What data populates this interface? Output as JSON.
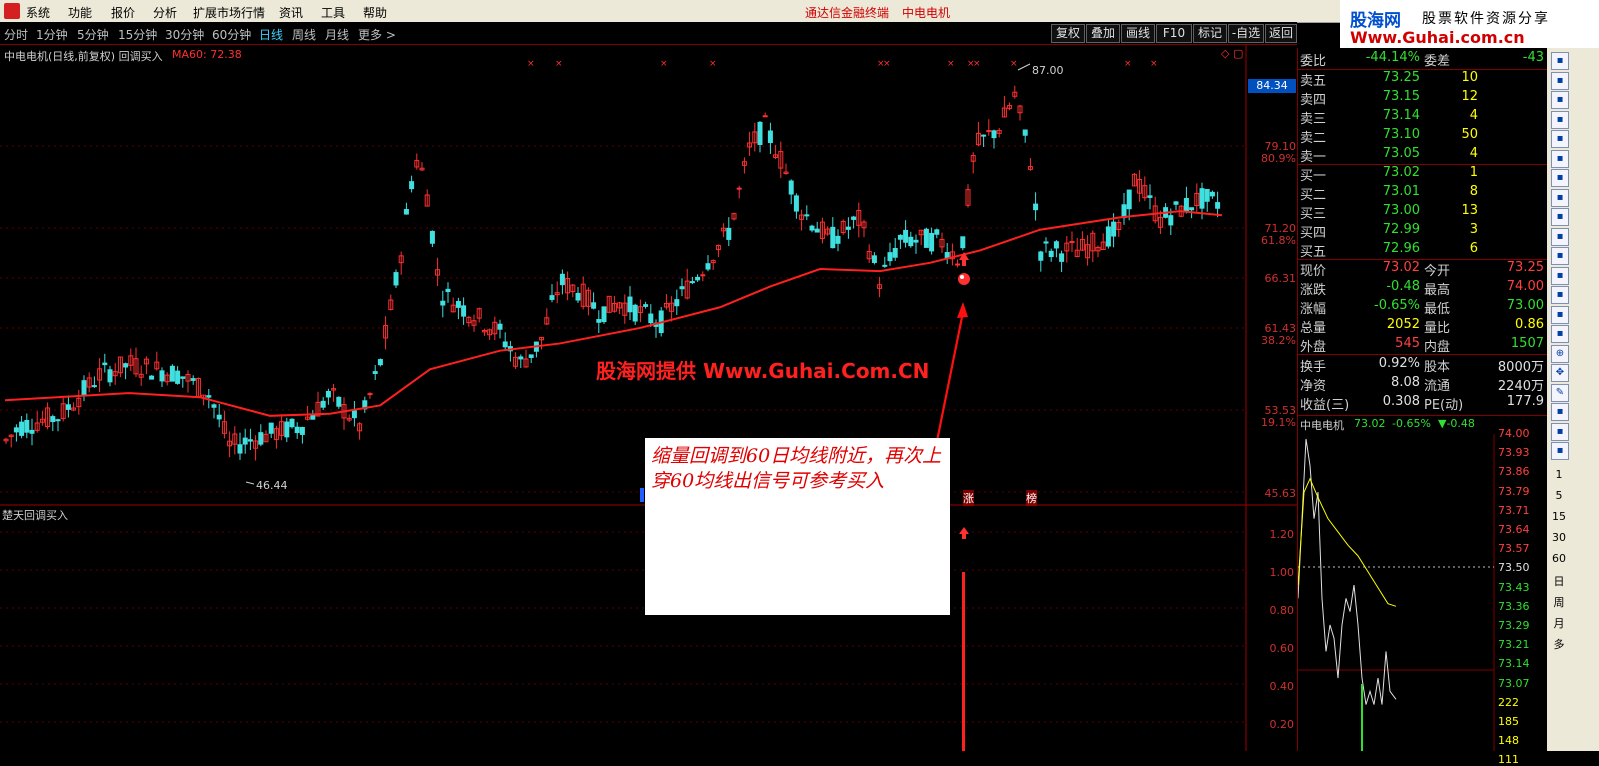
{
  "menubar": {
    "items": [
      "系统",
      "功能",
      "报价",
      "分析",
      "扩展市场行情",
      "资讯",
      "工具",
      "帮助"
    ],
    "app_title": "通达信金融终端",
    "stock_title": "中电电机"
  },
  "brand": {
    "name": "股海网",
    "slogan": "股票软件资源分享",
    "url": "Www.Guhai.com.cn"
  },
  "toolbar": {
    "periods": [
      "分时",
      "1分钟",
      "5分钟",
      "15分钟",
      "30分钟",
      "60分钟",
      "日线",
      "周线",
      "月线",
      "更多 >"
    ],
    "active_period": "日线",
    "buttons": [
      "复权",
      "叠加",
      "画线",
      "F10",
      "标记",
      "-自选",
      "返回"
    ]
  },
  "main_chart": {
    "title": "中电电机(日线,前复权) 回调买入",
    "ma_label": "MA60: 72.38",
    "high_label": "87.00",
    "low_label": "46.44",
    "price_tag": "84.34",
    "axis": [
      {
        "price": "79.10",
        "pct": "80.9%"
      },
      {
        "price": "71.20",
        "pct": "61.8%"
      },
      {
        "price": "66.31",
        "pct": ""
      },
      {
        "price": "61.43",
        "pct": "38.2%"
      },
      {
        "price": "53.53",
        "pct": "19.1%"
      },
      {
        "price": "45.63",
        "pct": ""
      }
    ],
    "markers": [
      "涨",
      "榜"
    ],
    "colors": {
      "up": "#ff3030",
      "down": "#40e0e0",
      "ma": "#ff2020"
    }
  },
  "indicator": {
    "title": "楚天回调买入",
    "axis": [
      "1.20",
      "1.00",
      "0.80",
      "0.60",
      "0.40",
      "0.20"
    ]
  },
  "annotation": {
    "text": "缩量回调到60日均线附近，再次上穿60均线出信号可参考买入"
  },
  "watermark": "股海网提供 Www.Guhai.Com.CN",
  "quote": {
    "header": {
      "k": "委比",
      "v": "-44.14%",
      "k2": "委差",
      "v2": "-43"
    },
    "sells": [
      {
        "k": "卖五",
        "p": "73.25",
        "v": "10"
      },
      {
        "k": "卖四",
        "p": "73.15",
        "v": "12"
      },
      {
        "k": "卖三",
        "p": "73.14",
        "v": "4"
      },
      {
        "k": "卖二",
        "p": "73.10",
        "v": "50"
      },
      {
        "k": "卖一",
        "p": "73.05",
        "v": "4"
      }
    ],
    "buys": [
      {
        "k": "买一",
        "p": "73.02",
        "v": "1"
      },
      {
        "k": "买二",
        "p": "73.01",
        "v": "8"
      },
      {
        "k": "买三",
        "p": "73.00",
        "v": "13"
      },
      {
        "k": "买四",
        "p": "72.99",
        "v": "3"
      },
      {
        "k": "买五",
        "p": "72.96",
        "v": "6"
      }
    ],
    "stats1": [
      {
        "k1": "现价",
        "v1": "73.02",
        "c1": "#ff4040",
        "k2": "今开",
        "v2": "73.25",
        "c2": "#ff4040"
      },
      {
        "k1": "涨跌",
        "v1": "-0.48",
        "c1": "#30e030",
        "k2": "最高",
        "v2": "74.00",
        "c2": "#ff4040"
      },
      {
        "k1": "涨幅",
        "v1": "-0.65%",
        "c1": "#30e030",
        "k2": "最低",
        "v2": "73.00",
        "c2": "#30e030"
      },
      {
        "k1": "总量",
        "v1": "2052",
        "c1": "#ffff00",
        "k2": "量比",
        "v2": "0.86",
        "c2": "#ffff00"
      },
      {
        "k1": "外盘",
        "v1": "545",
        "c1": "#ff4040",
        "k2": "内盘",
        "v2": "1507",
        "c2": "#30e030"
      }
    ],
    "stats2": [
      {
        "k1": "换手",
        "v1": "0.92%",
        "c1": "#e0e0e0",
        "k2": "股本",
        "v2": "8000万",
        "c2": "#e0e0e0"
      },
      {
        "k1": "净资",
        "v1": "8.08",
        "c1": "#e0e0e0",
        "k2": "流通",
        "v2": "2240万",
        "c2": "#e0e0e0"
      },
      {
        "k1": "收益(三)",
        "v1": "0.308",
        "c1": "#e0e0e0",
        "k2": "PE(动)",
        "v2": "177.9",
        "c2": "#e0e0e0"
      }
    ]
  },
  "minichart": {
    "name": "中电电机",
    "price": "73.02",
    "pct": "-0.65%",
    "chg": "▼-0.48",
    "axis": [
      "74.00",
      "73.93",
      "73.86",
      "73.79",
      "73.71",
      "73.64",
      "73.57",
      "73.50",
      "73.43",
      "73.36",
      "73.29",
      "73.21",
      "73.14",
      "73.07",
      "222",
      "185",
      "148",
      "111"
    ]
  },
  "iconbar": {
    "labels": [
      "1",
      "5",
      "15",
      "30",
      "60",
      "日",
      "周",
      "月",
      "多"
    ]
  }
}
